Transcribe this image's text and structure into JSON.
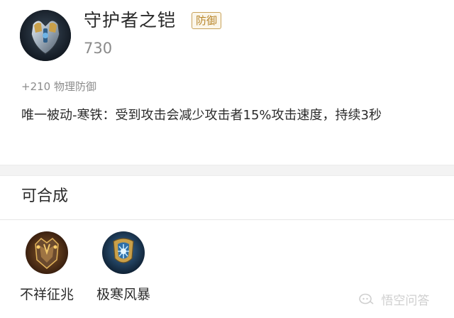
{
  "item": {
    "name": "守护者之铠",
    "tag": "防御",
    "price": "730",
    "stat": "+210 物理防御",
    "description": "唯一被动-寒铁：受到攻击会减少攻击者15%攻击速度，持续3秒",
    "icon": "armor-icon"
  },
  "crafting": {
    "title": "可合成",
    "items": [
      {
        "label": "不祥征兆",
        "icon": "ominous-omen-icon"
      },
      {
        "label": "极寒风暴",
        "icon": "frost-storm-icon"
      }
    ]
  },
  "watermark": {
    "text": "悟空问答",
    "icon": "wukong-logo-icon"
  },
  "colors": {
    "tag_border": "#c8a25a",
    "tag_text": "#b8862b",
    "divider": "#f3f3f3"
  }
}
